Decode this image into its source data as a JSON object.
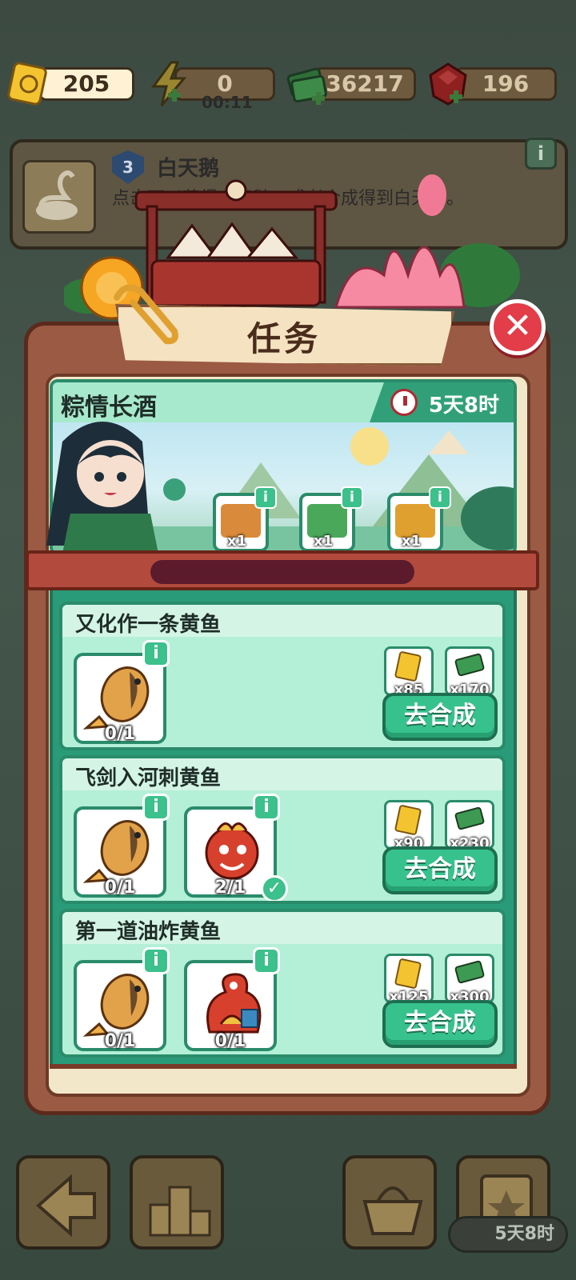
{
  "resources": {
    "tickets": {
      "value": "205"
    },
    "energy": {
      "value": "0",
      "timer": "00:11"
    },
    "cash": {
      "value": "36217"
    },
    "gems": {
      "value": "196"
    }
  },
  "info_banner": {
    "level": "3",
    "title": "白天鹅",
    "description": "点击可以获得白天鹅，或者合成得到白天鹅。"
  },
  "panel": {
    "title": "任务",
    "event": {
      "name": "粽情长酒",
      "time_left": "5天8时",
      "chests": [
        {
          "count": "x1",
          "color": "#d98a3a"
        },
        {
          "count": "x1",
          "color": "#4aa85a"
        },
        {
          "count": "x1",
          "color": "#e0a030"
        }
      ]
    },
    "tasks": [
      {
        "title": "又化作一条黄鱼",
        "items": [
          {
            "icon": "yellow-fish-icon",
            "progress": "0/1",
            "done": false
          }
        ],
        "rewards": [
          {
            "icon": "ticket-icon",
            "count": "x85"
          },
          {
            "icon": "cash-icon",
            "count": "x170"
          }
        ],
        "button": "去合成"
      },
      {
        "title": "飞剑入河刺黄鱼",
        "items": [
          {
            "icon": "yellow-fish-icon",
            "progress": "0/1",
            "done": false
          },
          {
            "icon": "dragon-head-icon",
            "progress": "2/1",
            "done": true
          }
        ],
        "rewards": [
          {
            "icon": "ticket-icon",
            "count": "x90"
          },
          {
            "icon": "cash-icon",
            "count": "x230"
          }
        ],
        "button": "去合成"
      },
      {
        "title": "第一道油炸黄鱼",
        "items": [
          {
            "icon": "yellow-fish-icon",
            "progress": "0/1",
            "done": false
          },
          {
            "icon": "dragon-icon",
            "progress": "0/1",
            "done": false
          }
        ],
        "rewards": [
          {
            "icon": "ticket-icon",
            "count": "x125"
          },
          {
            "icon": "cash-icon",
            "count": "x300"
          }
        ],
        "button": "去合成"
      }
    ]
  },
  "bottom": {
    "timer": "5天8时"
  },
  "colors": {
    "accent_green": "#37c28d",
    "close_red": "#e23d48",
    "panel_brown": "#9b5a43"
  }
}
